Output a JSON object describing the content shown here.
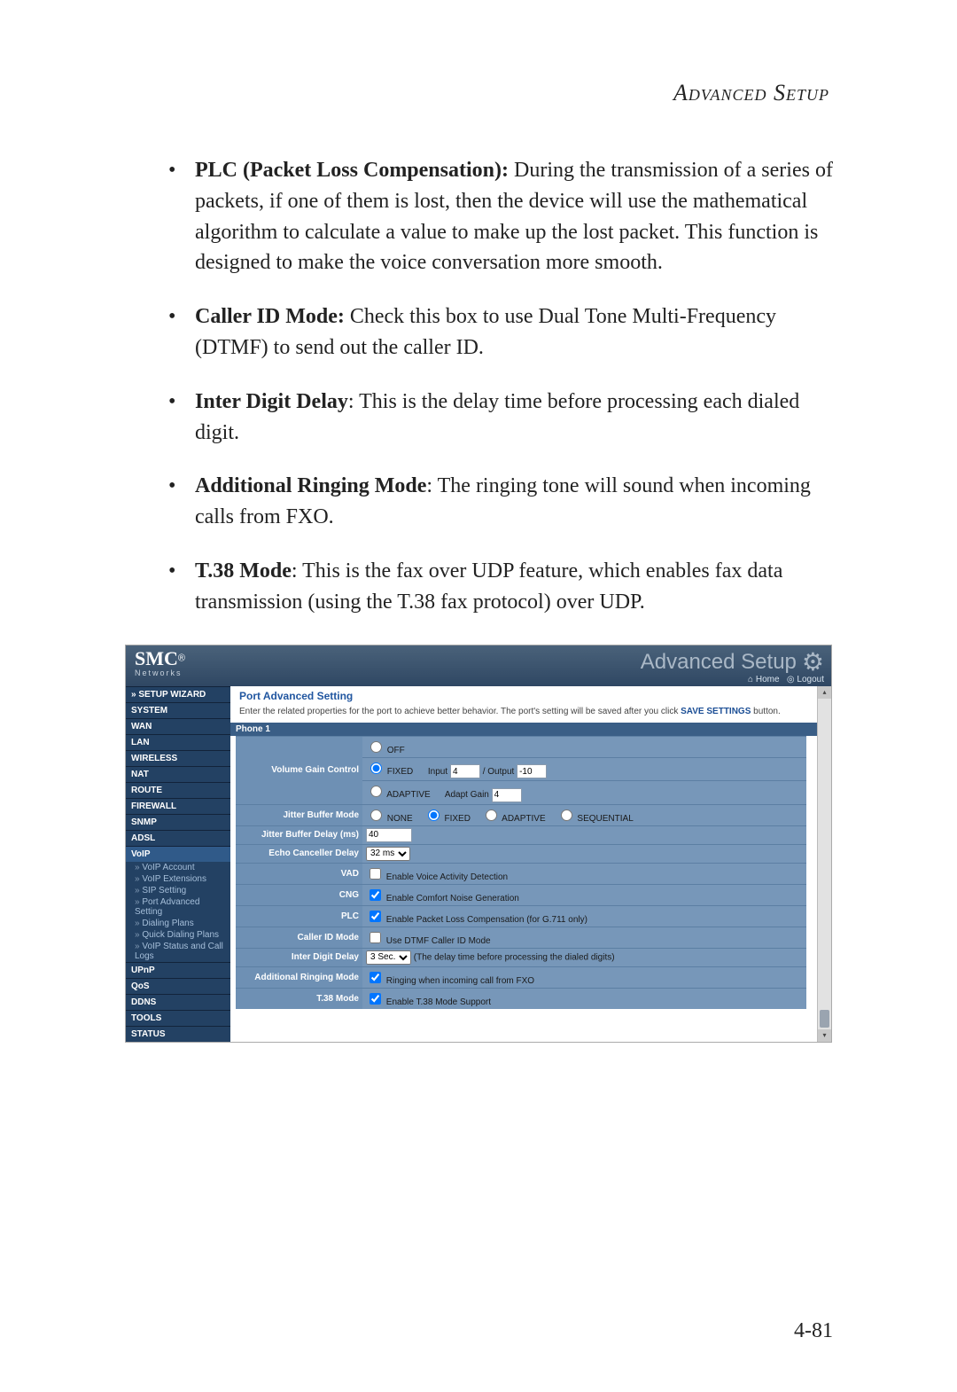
{
  "heading": "Advanced Setup",
  "bullets": [
    {
      "term": "PLC (Packet Loss Compensation):",
      "text": " During the transmission of a series of packets, if one of them is lost, then the device will use the mathematical algorithm to calculate a value to make up the lost packet. This function is designed to make the voice conversation more smooth."
    },
    {
      "term": "Caller ID Mode:",
      "text": " Check this box to use Dual Tone Multi-Frequency (DTMF) to send out the caller ID."
    },
    {
      "term": "Inter Digit Delay",
      "text": ": This is the delay time before processing each dialed digit."
    },
    {
      "term": "Additional Ringing Mode",
      "text": ": The ringing tone will sound when incoming calls from FXO."
    },
    {
      "term": "T.38 Mode",
      "text": ": This is the fax over UDP feature, which enables fax data transmission (using the T.38 fax protocol) over UDP."
    }
  ],
  "page_number": "4-81",
  "router": {
    "logo": "SMC",
    "logo_sub": "Networks",
    "adv_title": "Advanced Setup",
    "home": "Home",
    "logout": "Logout",
    "nav": [
      "» SETUP WIZARD",
      "SYSTEM",
      "WAN",
      "LAN",
      "WIRELESS",
      "NAT",
      "ROUTE",
      "FIREWALL",
      "SNMP",
      "ADSL",
      "VoIP"
    ],
    "voip_sub": [
      "VoIP Account",
      "VoIP Extensions",
      "SIP Setting",
      "Port Advanced Setting",
      "Dialing Plans",
      "Quick Dialing Plans",
      "VoIP Status and Call Logs"
    ],
    "nav2": [
      "UPnP",
      "QoS",
      "DDNS",
      "TOOLS",
      "STATUS"
    ],
    "content": {
      "title": "Port Advanced Setting",
      "desc_pre": "Enter the related properties for the port to achieve better behavior. The port's setting will be saved after you click ",
      "desc_bold": "SAVE SETTINGS",
      "desc_post": " button.",
      "phone": "Phone 1",
      "rows": {
        "vgc": {
          "label": "Volume Gain Control",
          "off": "OFF",
          "fixed": "FIXED",
          "input_lbl": "Input",
          "input_val": "4",
          "output_lbl": "/ Output",
          "output_val": "-10",
          "adaptive": "ADAPTIVE",
          "adapt_lbl": "Adapt Gain",
          "adapt_val": "4"
        },
        "jbm": {
          "label": "Jitter Buffer Mode",
          "opts": [
            "NONE",
            "FIXED",
            "ADAPTIVE",
            "SEQUENTIAL"
          ]
        },
        "jbd": {
          "label": "Jitter Buffer Delay (ms)",
          "val": "40"
        },
        "ecd": {
          "label": "Echo Canceller Delay",
          "val": "32 ms"
        },
        "vad": {
          "label": "VAD",
          "text": "Enable Voice Activity Detection"
        },
        "cng": {
          "label": "CNG",
          "text": "Enable Comfort Noise Generation"
        },
        "plc": {
          "label": "PLC",
          "text": "Enable Packet Loss Compensation (for G.711 only)"
        },
        "cid": {
          "label": "Caller ID Mode",
          "text": "Use DTMF Caller ID Mode"
        },
        "idd": {
          "label": "Inter Digit Delay",
          "sel": "3 Sec.",
          "text": "(The delay time before processing the dialed digits)"
        },
        "arm": {
          "label": "Additional Ringing Mode",
          "text": "Ringing when incoming call from FXO"
        },
        "t38": {
          "label": "T.38 Mode",
          "text": "Enable T.38 Mode Support"
        }
      }
    }
  }
}
